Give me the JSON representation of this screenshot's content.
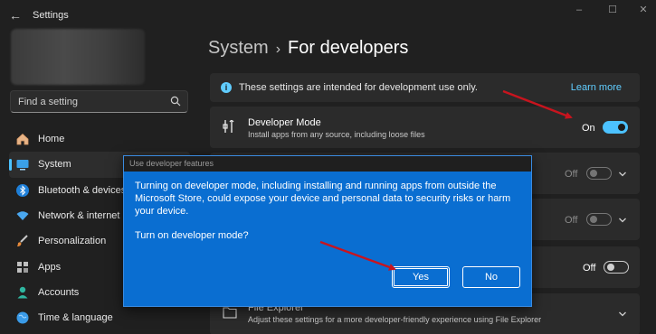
{
  "window": {
    "title": "Settings",
    "controls": [
      "–",
      "☐",
      "✕"
    ]
  },
  "sidebar": {
    "search_placeholder": "Find a setting",
    "items": [
      {
        "label": "Home",
        "icon": "home-icon",
        "selected": false
      },
      {
        "label": "System",
        "icon": "system-icon",
        "selected": true
      },
      {
        "label": "Bluetooth & devices",
        "icon": "bluetooth-icon",
        "selected": false
      },
      {
        "label": "Network & internet",
        "icon": "network-icon",
        "selected": false
      },
      {
        "label": "Personalization",
        "icon": "brush-icon",
        "selected": false
      },
      {
        "label": "Apps",
        "icon": "apps-icon",
        "selected": false
      },
      {
        "label": "Accounts",
        "icon": "account-icon",
        "selected": false
      },
      {
        "label": "Time & language",
        "icon": "globe-icon",
        "selected": false
      }
    ]
  },
  "header": {
    "breadcrumb_parent": "System",
    "breadcrumb_separator": "›",
    "page_title": "For developers"
  },
  "info_bar": {
    "text": "These settings are intended for development use only.",
    "link": "Learn more"
  },
  "developer_mode": {
    "title": "Developer Mode",
    "description": "Install apps from any source, including loose files",
    "state_label": "On",
    "state": true
  },
  "hidden_rows": [
    {
      "state_label": "Off",
      "state": false
    },
    {
      "state_label": "Off",
      "state": false
    },
    {
      "state_label": "Off",
      "state": false
    }
  ],
  "file_explorer": {
    "title": "File Explorer",
    "description": "Adjust these settings for a more developer-friendly experience using File Explorer"
  },
  "dialog": {
    "title": "Use developer features",
    "body": "Turning on developer mode, including installing and running apps from outside the Microsoft Store, could expose your device and personal data to security risks or harm your device.",
    "question": "Turn on developer mode?",
    "yes_label": "Yes",
    "no_label": "No"
  },
  "colors": {
    "accent": "#4cc2ff",
    "dialog_bg": "#0a6ed1",
    "arrow": "#c8141e"
  }
}
